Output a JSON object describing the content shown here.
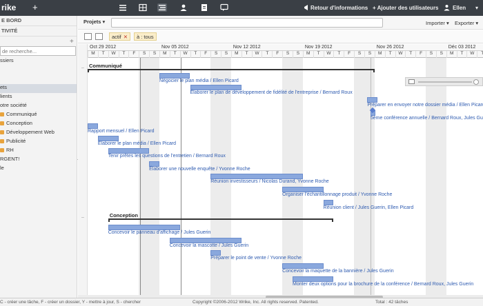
{
  "topbar": {
    "logo": "rike",
    "plus": "+",
    "icons": [
      "menu-icon",
      "grid-icon",
      "list-icon",
      "person-icon",
      "document-icon",
      "chat-icon"
    ],
    "feedback": "Retour d'informations",
    "add_users": "+ Ajouter des utilisateurs",
    "user": "Ellen",
    "more": "▾"
  },
  "sidebar": {
    "dashboard": "E BORD",
    "activity": "TIVITÉ",
    "plus": "+",
    "search_placeholder": "de recherche...",
    "items": [
      {
        "label": "ssiers",
        "indent": 0,
        "dot": ""
      },
      {
        "label": "",
        "indent": 0,
        "dot": ""
      },
      {
        "label": "ets",
        "indent": 0,
        "dot": "",
        "selected": true
      },
      {
        "label": "lients",
        "indent": 1,
        "dot": ""
      },
      {
        "label": "otre société",
        "indent": 1,
        "dot": ""
      },
      {
        "label": "Communiqué",
        "indent": 2,
        "dot": "#e8a33c"
      },
      {
        "label": "Conception",
        "indent": 2,
        "dot": "#e8a33c"
      },
      {
        "label": "Développement Web",
        "indent": 2,
        "dot": "#e8a33c"
      },
      {
        "label": "Publicité",
        "indent": 2,
        "dot": "#e8a33c"
      },
      {
        "label": "RH",
        "indent": 2,
        "dot": "#e8a33c"
      },
      {
        "label": "RGENT!",
        "indent": 0,
        "dot": ""
      },
      {
        "label": "le",
        "indent": 0,
        "dot": ""
      }
    ]
  },
  "toolbar": {
    "projects": "Projets ▾",
    "import": "Importer ▾",
    "export": "Exporter ▾"
  },
  "filters": {
    "active_chip": "actif",
    "close": "✕",
    "to_chip": "à : tous"
  },
  "gantt": {
    "weeks": [
      "Oct 29 2012",
      "Nov 05 2012",
      "Nov 12 2012",
      "Nov 19 2012",
      "Nov 26 2012",
      "Déc 03 2012"
    ],
    "day_letters": [
      "M",
      "T",
      "W",
      "T",
      "F",
      "S",
      "S"
    ],
    "groups": [
      {
        "name": "Communiqué"
      },
      {
        "name": "Conception"
      }
    ],
    "tasks": [
      {
        "label": "Négocier le plan média / Ellen Picard"
      },
      {
        "label": "Élaborer le plan de développement de fidélité de l'entreprise / Bernard Roux"
      },
      {
        "label": "Préparer en envoyer notre dossier média / Ellen Picard"
      },
      {
        "label": "5ème conférence annuelle / Bernard Roux, Jules Guerin"
      },
      {
        "label": "Rapport mensuel / Ellen Picard"
      },
      {
        "label": "Élaborer le plan média / Ellen Picard"
      },
      {
        "label": "Tenir prêtes les questions de l'entretien / Bernard Roux"
      },
      {
        "label": "Élaborer une nouvelle enquête / Yvonne Roche"
      },
      {
        "label": "Réunion investisseurs / Nicolas Durand, Yvonne Roche"
      },
      {
        "label": "Organiser l'échantillonnage produit / Yvonne Roche"
      },
      {
        "label": "Réunion client / Jules Guerin, Ellen Picard"
      },
      {
        "label": "Concevoir le panneau d'affichage / Jules Guerin"
      },
      {
        "label": "Concevoir la mascotte / Jules Guerin"
      },
      {
        "label": "Préparer le point de vente / Yvonne Roche"
      },
      {
        "label": "Concevoir la maquette de la bannière / Jules Guerin"
      },
      {
        "label": "Monter deux options pour la brochure de la conférence / Bernard Roux, Jules Guerin"
      }
    ]
  },
  "status": {
    "shortcuts": "C - créer une tâche, F - créer un dossier, Y - mettre à jour, S - chercher",
    "copyright": "Copyright ©2006-2012 Wrike, Inc. All rights reserved. Patented.",
    "total": "Total : 42 tâches"
  }
}
